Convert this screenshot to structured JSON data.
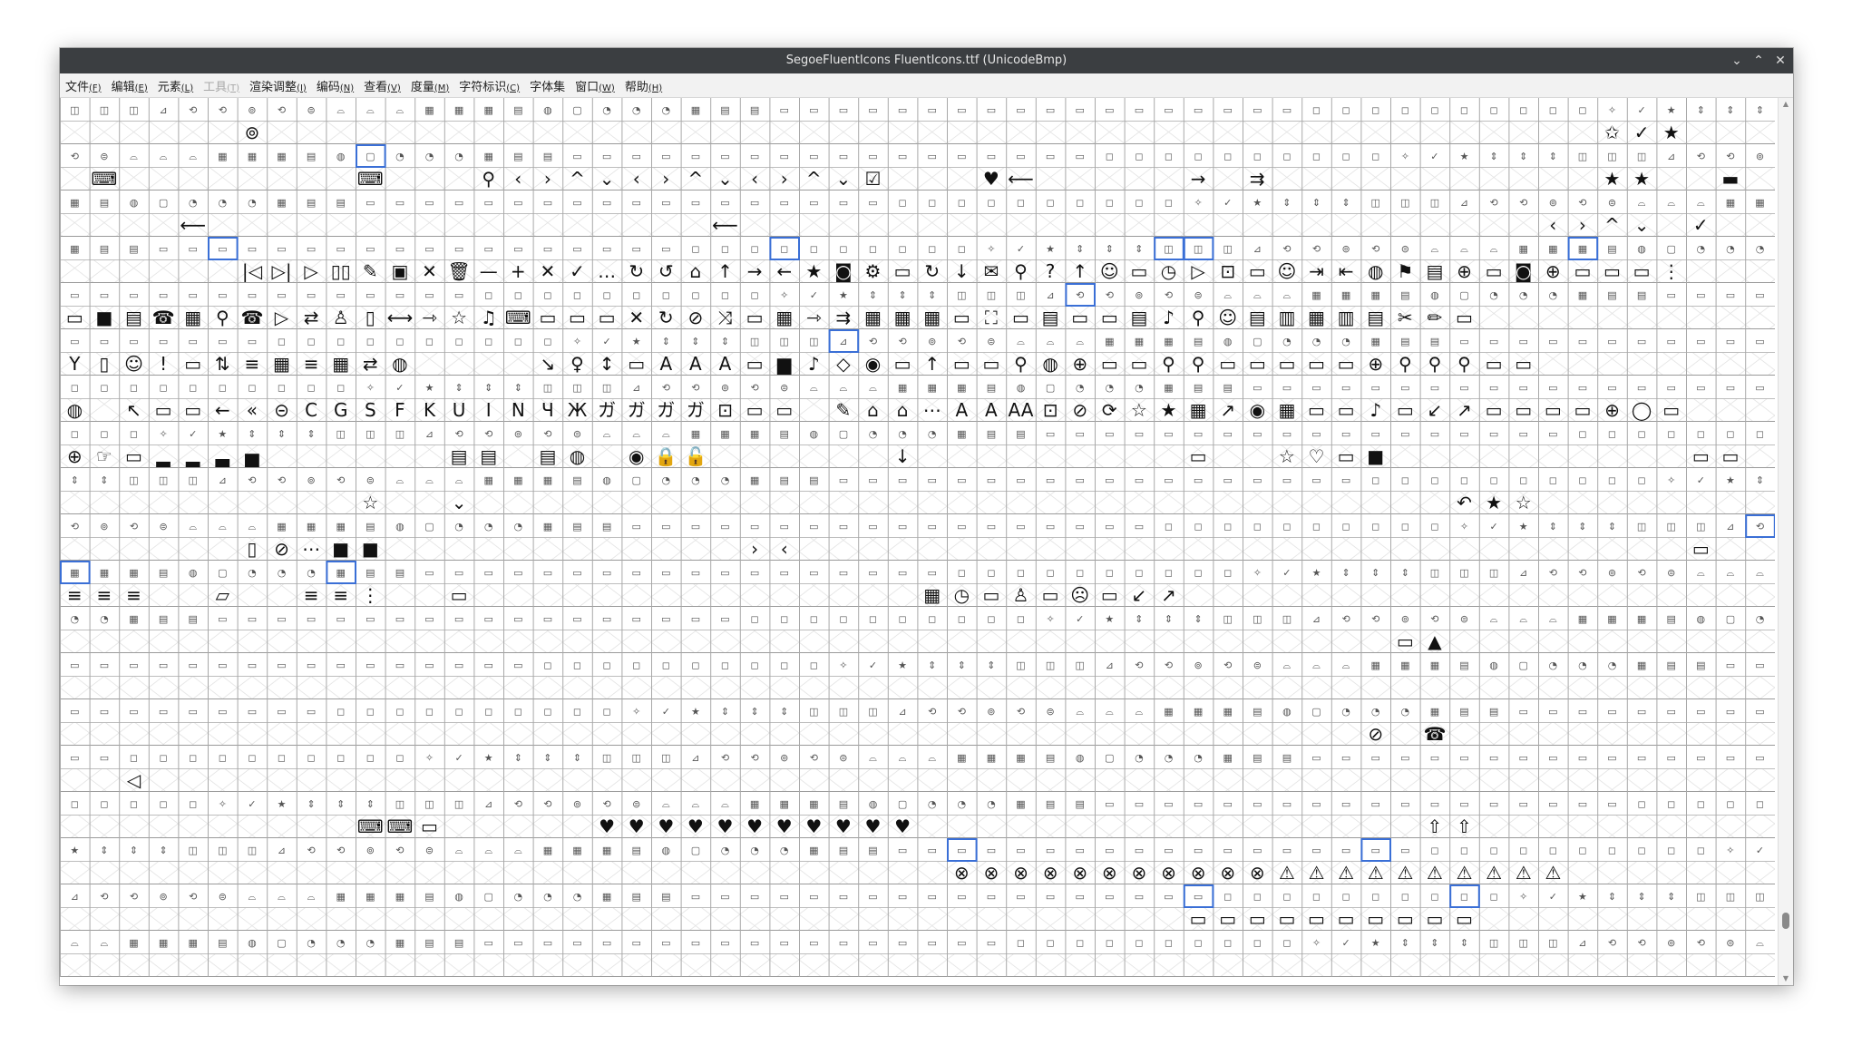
{
  "window": {
    "title": "SegoeFluentIcons FluentIcons.ttf (UnicodeBmp)",
    "controls": {
      "minimize": "⌄",
      "maximize": "⌃",
      "close": "✕"
    }
  },
  "menubar": [
    {
      "label": "文件",
      "mnemonic": "(F)",
      "enabled": true
    },
    {
      "label": "编辑",
      "mnemonic": "(E)",
      "enabled": true
    },
    {
      "label": "元素",
      "mnemonic": "(L)",
      "enabled": true
    },
    {
      "label": "工具",
      "mnemonic": "(T)",
      "enabled": false
    },
    {
      "label": "渲染调整",
      "mnemonic": "(I)",
      "enabled": true
    },
    {
      "label": "编码",
      "mnemonic": "(N)",
      "enabled": true
    },
    {
      "label": "查看",
      "mnemonic": "(V)",
      "enabled": true
    },
    {
      "label": "度量",
      "mnemonic": "(M)",
      "enabled": true
    },
    {
      "label": "字符标识",
      "mnemonic": "(C)",
      "enabled": true
    },
    {
      "label": "字体集",
      "mnemonic": "",
      "enabled": true
    },
    {
      "label": "窗口",
      "mnemonic": "(W)",
      "enabled": true
    },
    {
      "label": "帮助",
      "mnemonic": "(H)",
      "enabled": true
    }
  ],
  "glyph_grid": {
    "columns": 58,
    "rows": 19,
    "header_glyphs": [
      "◫",
      "◫",
      "◫",
      "⊿",
      "⟲",
      "⟲",
      "⊚",
      "⟲",
      "⊜",
      "⌓",
      "⌓",
      "⌓",
      "▦",
      "▦",
      "▦",
      "▤",
      "◍",
      "▢",
      "◔",
      "◔",
      "◔",
      "▦",
      "▤",
      "▤",
      "▭",
      "▭",
      "▭",
      "▭",
      "▭",
      "▭",
      "▭",
      "▭",
      "▭",
      "▭",
      "▭",
      "▭",
      "▭",
      "▭",
      "▭",
      "▭",
      "▭",
      "▭",
      "◻",
      "◻",
      "◻",
      "◻",
      "◻",
      "◻",
      "◻",
      "◻",
      "◻",
      "◻",
      "✧",
      "✓",
      "★",
      "⇕",
      "⇕",
      "⇕"
    ],
    "row_glyphs": [
      [
        "",
        "",
        "",
        "",
        "",
        "",
        "⊚",
        "",
        "",
        "",
        "",
        "",
        "",
        "",
        "",
        "",
        "",
        "",
        "",
        "",
        "",
        "",
        "",
        "",
        "",
        "",
        "",
        "",
        "",
        "",
        "",
        "",
        "",
        "",
        "",
        "",
        "",
        "",
        "",
        "",
        "",
        "",
        "",
        "",
        "",
        "",
        "",
        "",
        "",
        "",
        "",
        "",
        "✩",
        "✓",
        "★",
        "",
        "",
        ""
      ],
      [
        "",
        "⌨",
        "",
        "",
        "",
        "",
        "",
        "",
        "",
        "",
        "⌨",
        "",
        "",
        "",
        "⚲",
        "‹",
        "›",
        "^",
        "⌄",
        "‹",
        "›",
        "^",
        "⌄",
        "‹",
        "›",
        "^",
        "⌄",
        "☑",
        "",
        "",
        "",
        "♥",
        "⟵",
        "",
        "",
        "",
        "",
        "",
        "→",
        "",
        "⇉",
        "",
        "",
        "",
        "",
        "",
        "",
        "",
        "",
        "",
        "",
        "",
        "★",
        "★",
        "",
        "",
        "▬",
        "",
        "",
        ""
      ],
      [
        "",
        "",
        "",
        "",
        "⟵",
        "",
        "",
        "",
        "",
        "",
        "",
        "",
        "",
        "",
        "",
        "",
        "",
        "",
        "",
        "",
        "",
        "",
        "⟵",
        "",
        "",
        "",
        "",
        "",
        "",
        "",
        "",
        "",
        "",
        "",
        "",
        "",
        "",
        "",
        "",
        "",
        "",
        "",
        "",
        "",
        "",
        "",
        "",
        "",
        "",
        "",
        "‹",
        "›",
        "^",
        "⌄",
        "",
        "✓",
        "",
        "",
        "",
        "",
        "",
        "",
        "",
        "",
        "",
        "",
        "",
        "",
        ""
      ],
      [
        "",
        "",
        "",
        "",
        "",
        "",
        "|◁",
        "▷|",
        "▷",
        "▯▯",
        "✎",
        "▣",
        "✕",
        "🗑",
        "—",
        "+",
        "✕",
        "✓",
        "…",
        "↻",
        "↺",
        "⌂",
        "↑",
        "→",
        "←",
        "★",
        "◙",
        "⚙",
        "▭",
        "↻",
        "↓",
        "✉",
        "⚲",
        "?",
        "↑",
        "☺",
        "▭",
        "◷",
        "▷",
        "⊡",
        "▭",
        "☺",
        "⇥",
        "⇤",
        "◍",
        "⚑",
        "▤",
        "⊕",
        "▭",
        "◙",
        "⊕",
        "▭",
        "▭",
        "▭",
        "⋮"
      ],
      [
        "▭",
        "■",
        "▤",
        "☎",
        "▦",
        "⚲",
        "☎",
        "▷",
        "⇄",
        "♙",
        "▯",
        "⟷",
        "⇾",
        "☆",
        "♫",
        "⌨",
        "▭",
        "▭",
        "▭",
        "✕",
        "↻",
        "⊘",
        "⤨",
        "▭",
        "▦",
        "⇾",
        "⇉",
        "▦",
        "▦",
        "▦",
        "▭",
        "⛶",
        "▭",
        "▤",
        "▭",
        "▭",
        "▤",
        "♪",
        "⚲",
        "☺",
        "▤",
        "▥",
        "▦",
        "▥",
        "▤",
        "✂",
        "✏",
        "▭"
      ],
      [
        "Y",
        "▯",
        "☺",
        "!",
        "▭",
        "⇅",
        "≡",
        "▦",
        "≡",
        "▦",
        "⇄",
        "◍",
        "",
        "",
        "",
        "",
        "↘",
        "♀",
        "↕",
        "▭",
        "A",
        "A",
        "A",
        "▭",
        "▆",
        "♪",
        "◇",
        "◉",
        "▭",
        "↑",
        "▭",
        "▭",
        "⚲",
        "◍",
        "⊕",
        "▭",
        "▭",
        "⚲",
        "⚲",
        "▭",
        "▭",
        "▭",
        "▭",
        "▭",
        "⊕",
        "⚲",
        "⚲",
        "⚲",
        "▭",
        "▭"
      ],
      [
        "◍",
        "",
        "↖",
        "▭",
        "▭",
        "←",
        "«",
        "⊝",
        "C",
        "G",
        "S",
        "F",
        "K",
        "U",
        "I",
        "N",
        "Ч",
        "Ж",
        "ガ",
        "ガ",
        "ガ",
        "ガ",
        "⊡",
        "▭",
        "▭",
        "",
        "✎",
        "⌂",
        "⌂",
        "⋯",
        "A",
        "A",
        "AA",
        "⊡",
        "⊘",
        "⟳",
        "☆",
        "★",
        "▦",
        "↗",
        "◉",
        "▦",
        "▭",
        "▭",
        "♪",
        "▭",
        "↙",
        "↗",
        "▭",
        "▭",
        "▭",
        "▭",
        "⊕",
        "◯",
        "▭"
      ],
      [
        "⊕",
        "☞",
        "▭",
        "▂",
        "▂",
        "▃",
        "▅",
        "",
        "",
        "",
        "",
        "",
        "",
        "▤",
        "▤",
        "",
        "▤",
        "◍",
        "",
        "◉",
        "🔒",
        "🔓",
        "",
        "",
        "",
        "",
        "",
        "",
        "↓",
        "",
        "",
        "",
        "",
        "",
        "",
        "",
        "",
        "",
        "▭",
        "",
        "",
        "☆",
        "♡",
        "▭",
        "■",
        "",
        "",
        "",
        "",
        "",
        "",
        "",
        "",
        "",
        "",
        "▭",
        "▭",
        "",
        ""
      ],
      [
        "",
        "",
        "",
        "",
        "",
        "",
        "",
        "",
        "",
        "",
        "☆",
        "",
        "",
        "⌄",
        "",
        "",
        "",
        "",
        "",
        "",
        "",
        "",
        "",
        "",
        "",
        "",
        "",
        "",
        "",
        "",
        "",
        "",
        "",
        "",
        "",
        "",
        "",
        "",
        "",
        "",
        "",
        "",
        "",
        "",
        "",
        "",
        "",
        "↶",
        "★",
        "☆",
        "",
        "",
        "",
        "",
        "",
        "",
        "",
        ""
      ],
      [
        "",
        "",
        "",
        "",
        "",
        "",
        "▯",
        "⊘",
        "⋯",
        "■",
        "■",
        "",
        "",
        "",
        "",
        "",
        "",
        "",
        "",
        "",
        "",
        "",
        "",
        "›",
        "‹",
        "",
        "",
        "",
        "",
        "",
        "",
        "",
        "",
        "",
        "",
        "",
        "",
        "",
        "",
        "",
        "",
        "",
        "",
        "",
        "",
        "",
        "",
        "",
        "",
        "",
        "",
        "",
        "",
        "",
        "",
        "▭"
      ],
      [
        "≡",
        "≡",
        "≡",
        "",
        "",
        "▱",
        "",
        "",
        "≡",
        "≡",
        "⋮",
        "",
        "",
        "▭",
        "",
        "",
        "",
        "",
        "",
        "",
        "",
        "",
        "",
        "",
        "",
        "",
        "",
        "",
        "",
        "▦",
        "◷",
        "▭",
        "♙",
        "▭",
        "☹",
        "▭",
        "↙",
        "↗",
        "",
        "",
        "",
        "",
        "",
        "",
        "",
        "",
        "",
        "",
        "",
        "",
        "",
        "",
        "",
        "",
        ""
      ],
      [
        "",
        "",
        "",
        "",
        "",
        "",
        "",
        "",
        "",
        "",
        "",
        "",
        "",
        "",
        "",
        "",
        "",
        "",
        "",
        "",
        "",
        "",
        "",
        "",
        "",
        "",
        "",
        "",
        "",
        "",
        "",
        "",
        "",
        "",
        "",
        "",
        "",
        "",
        "",
        "",
        "",
        "",
        "",
        "",
        "",
        "▭",
        "▲",
        "",
        "",
        "",
        "",
        "",
        "",
        "",
        "",
        "",
        ""
      ],
      [
        "",
        "",
        "",
        "",
        "",
        "",
        "",
        "",
        "",
        "",
        "",
        "",
        "",
        "",
        "",
        "",
        "",
        "",
        "",
        "",
        "",
        "",
        "",
        "",
        "",
        "",
        "",
        "",
        "",
        "",
        "",
        "",
        "",
        "",
        "",
        "",
        "",
        "",
        "",
        "",
        "",
        "",
        "",
        "",
        "",
        "",
        "",
        "",
        "",
        "",
        "",
        "",
        "",
        "",
        "",
        "",
        "",
        ""
      ],
      [
        "",
        "",
        "",
        "",
        "",
        "",
        "",
        "",
        "",
        "",
        "",
        "",
        "",
        "",
        "",
        "",
        "",
        "",
        "",
        "",
        "",
        "",
        "",
        "",
        "",
        "",
        "",
        "",
        "",
        "",
        "",
        "",
        "",
        "",
        "",
        "",
        "",
        "",
        "",
        "",
        "",
        "",
        "",
        "",
        "⊘",
        "",
        "☎",
        "",
        "",
        "",
        "",
        "",
        "",
        "",
        "",
        "",
        "",
        "",
        "",
        "",
        ""
      ],
      [
        "",
        "",
        "◁",
        "",
        "",
        "",
        "",
        "",
        "",
        "",
        "",
        "",
        "",
        "",
        "",
        "",
        "",
        "",
        "",
        "",
        "",
        "",
        "",
        "",
        "",
        "",
        "",
        "",
        "",
        "",
        "",
        "",
        "",
        "",
        "",
        "",
        "",
        "",
        "",
        "",
        "",
        "",
        "",
        "",
        "",
        "",
        "",
        "",
        "",
        "",
        "",
        "",
        "",
        "",
        "",
        "",
        ""
      ],
      [
        "",
        "",
        "",
        "",
        "",
        "",
        "",
        "",
        "",
        "",
        "⌨",
        "⌨",
        "▭",
        "",
        "",
        "",
        "",
        "",
        "♥",
        "♥",
        "♥",
        "♥",
        "♥",
        "♥",
        "♥",
        "♥",
        "♥",
        "♥",
        "♥",
        "",
        "",
        "",
        "",
        "",
        "",
        "",
        "",
        "",
        "",
        "",
        "",
        "",
        "",
        "",
        "",
        "",
        "⇧",
        "⇧",
        "",
        "",
        "",
        "",
        "",
        "",
        "",
        "",
        ""
      ],
      [
        "",
        "",
        "",
        "",
        "",
        "",
        "",
        "",
        "",
        "",
        "",
        "",
        "",
        "",
        "",
        "",
        "",
        "",
        "",
        "",
        "",
        "",
        "",
        "",
        "",
        "",
        "",
        "",
        "",
        "",
        "⊗",
        "⊗",
        "⊗",
        "⊗",
        "⊗",
        "⊗",
        "⊗",
        "⊗",
        "⊗",
        "⊗",
        "⊗",
        "⚠",
        "⚠",
        "⚠",
        "⚠",
        "⚠",
        "⚠",
        "⚠",
        "⚠",
        "⚠",
        "⚠",
        "",
        "",
        "",
        "",
        "",
        "",
        "",
        ""
      ],
      [
        "",
        "",
        "",
        "",
        "",
        "",
        "",
        "",
        "",
        "",
        "",
        "",
        "",
        "",
        "",
        "",
        "",
        "",
        "",
        "",
        "",
        "",
        "",
        "",
        "",
        "",
        "",
        "",
        "",
        "",
        "",
        "",
        "",
        "",
        "",
        "",
        "",
        "",
        "▭",
        "▭",
        "▭",
        "▭",
        "▭",
        "▭",
        "▭",
        "▭",
        "▭",
        "▭",
        "",
        "",
        "",
        "",
        "",
        "",
        "",
        "",
        "",
        "",
        ""
      ],
      [
        "",
        "",
        "",
        "",
        "",
        "",
        "",
        "",
        "",
        "",
        "",
        "",
        "",
        "",
        "",
        "",
        "",
        "",
        "",
        "",
        "",
        "",
        "",
        "",
        "",
        "",
        "",
        "",
        "",
        "",
        "",
        "",
        "",
        "",
        "",
        "",
        "",
        "",
        "",
        "",
        "",
        "",
        "",
        "",
        "",
        "",
        "",
        "",
        "",
        "",
        "",
        "",
        "",
        "",
        "",
        "",
        "",
        ""
      ]
    ]
  }
}
